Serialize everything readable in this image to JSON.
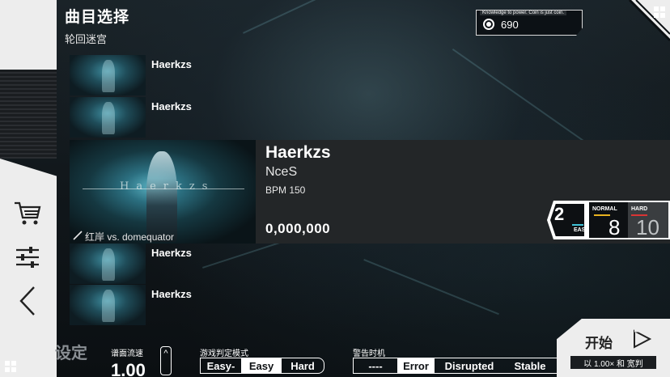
{
  "header": {
    "title": "曲目选择",
    "subtitle": "轮回迷宫"
  },
  "coins": {
    "tip": "Knowledge to power. Coin is just coin.",
    "value": "690"
  },
  "song_list": [
    {
      "name": "Haerkzs"
    },
    {
      "name": "Haerkzs"
    },
    {
      "name": "Haerkzs"
    },
    {
      "name": "Haerkzs"
    }
  ],
  "selected_song": {
    "title": "Haerkzs",
    "artist": "NceS",
    "bpm": "BPM 150",
    "score": "0,000,000",
    "art_credit": "红岸 vs. domequator",
    "art_text": "Haerkzs"
  },
  "difficulty": {
    "easy": {
      "label": "EASY",
      "level": "2",
      "color": "#3fc1d6"
    },
    "normal": {
      "label": "NORMAL",
      "level": "8",
      "color": "#e8b320"
    },
    "hard": {
      "label": "HARD",
      "level": "10",
      "color": "#d93434"
    }
  },
  "bottom": {
    "settings_label": "设定",
    "speed_label": "谱面流速",
    "speed_value": "1.00",
    "stepper_icon": "^",
    "judge_label": "游戏判定模式",
    "judge_options": [
      "Easy-",
      "Easy",
      "Hard"
    ],
    "judge_selected": "Easy",
    "warn_label": "警告时机",
    "warn_options": [
      "----",
      "Error",
      "Disrupted",
      "Stable"
    ],
    "warn_selected": "Error",
    "start_label": "开始",
    "start_sub": "以 1.00× 和 宽判"
  }
}
